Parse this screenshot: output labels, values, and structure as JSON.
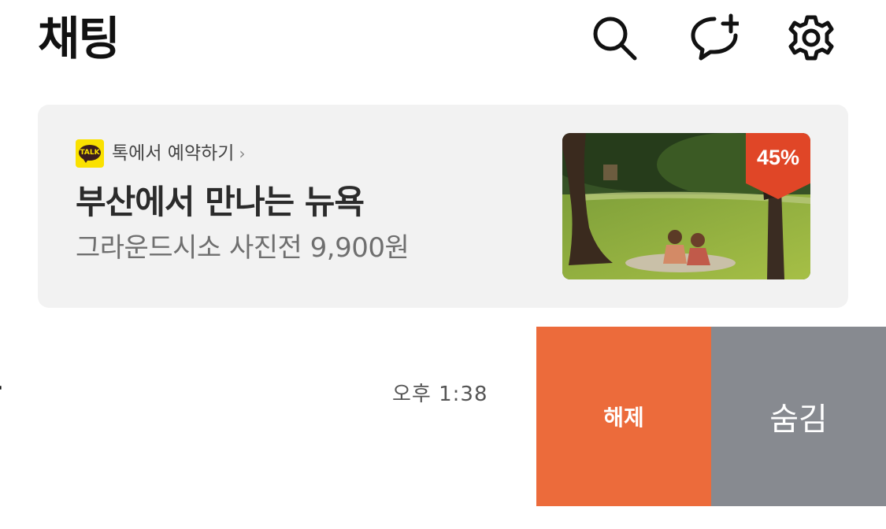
{
  "header": {
    "title": "채팅",
    "icons": [
      "search-icon",
      "new-chat-icon",
      "gear-icon"
    ]
  },
  "banner": {
    "badge_text": "TALK",
    "label": "톡에서 예약하기",
    "label_chevron": "›",
    "title": "부산에서 만나는 뉴욕",
    "subtitle": "그라운드시소 사진전 9,900원",
    "discount": "45%"
  },
  "chat": {
    "name": "방",
    "time": "오후 1:38"
  },
  "swipe_actions": {
    "unpin": "해제",
    "hide": "숨김"
  },
  "colors": {
    "unpin_bg": "#ec6b3b",
    "hide_bg": "#878a90",
    "discount_bg": "#e04627",
    "talk_yellow": "#fae100"
  }
}
